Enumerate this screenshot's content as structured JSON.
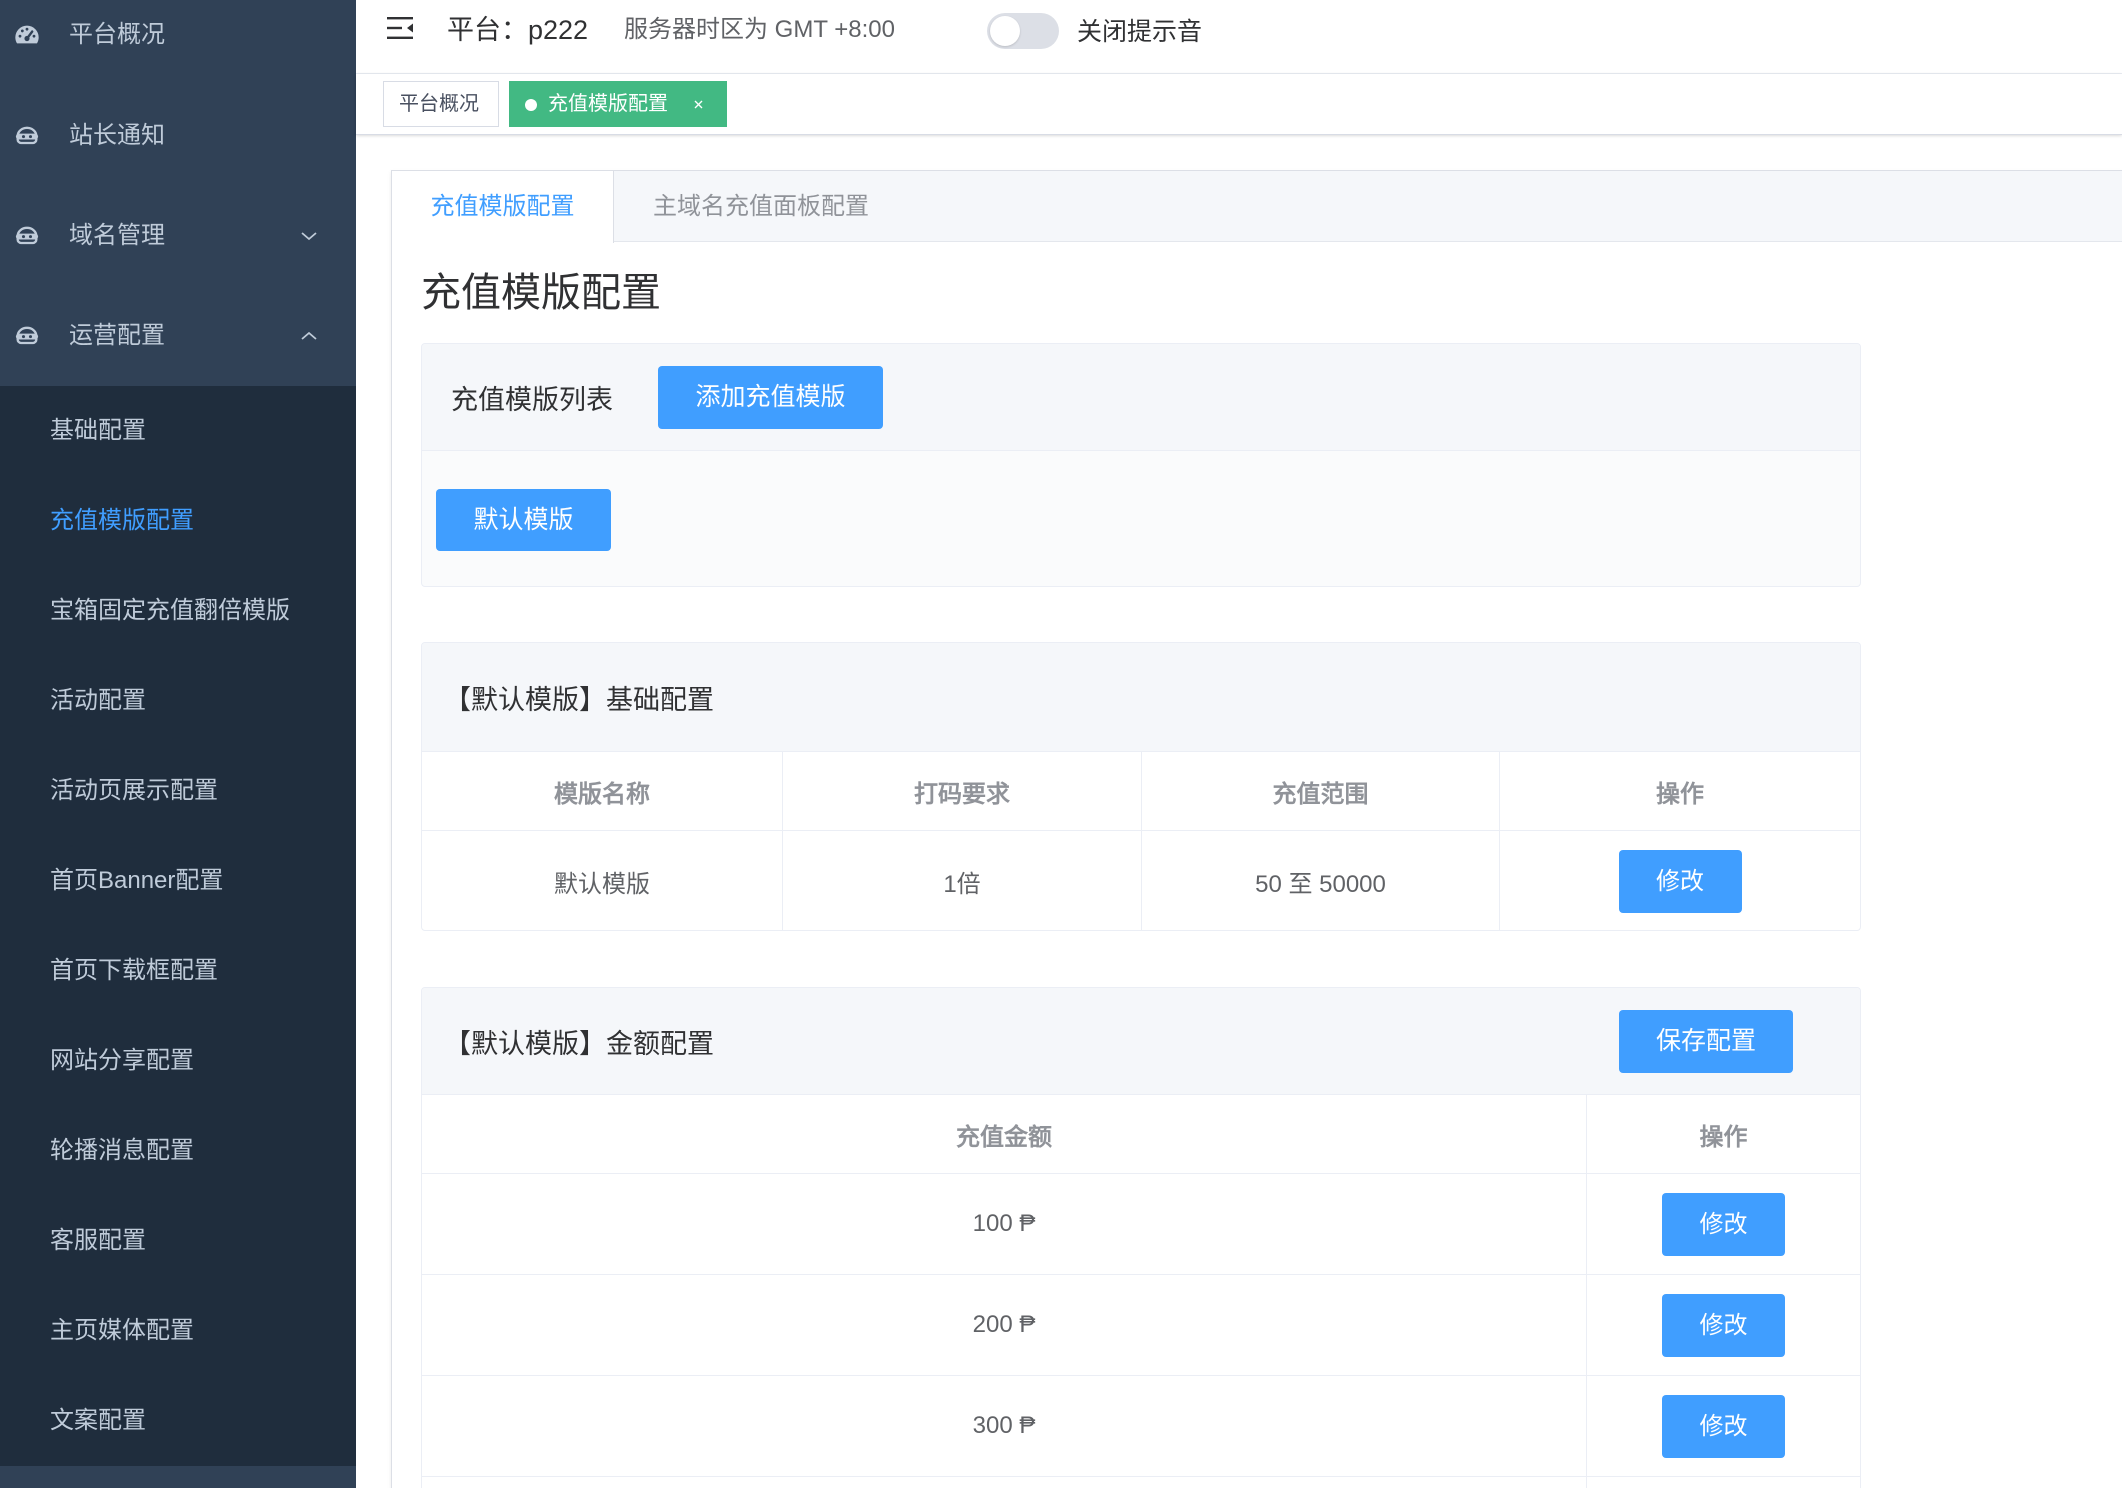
{
  "sidebar": {
    "menu": [
      {
        "label": "平台概况",
        "icon": "dashboard-icon"
      },
      {
        "label": "站长通知",
        "icon": "robot-icon"
      },
      {
        "label": "域名管理",
        "icon": "robot-icon",
        "expand_icon": "chevron-down-icon"
      },
      {
        "label": "运营配置",
        "icon": "robot-icon",
        "expand_icon": "chevron-up-icon"
      }
    ],
    "submenu": [
      "基础配置",
      "充值模版配置",
      "宝箱固定充值翻倍模版",
      "活动配置",
      "活动页展示配置",
      "首页Banner配置",
      "首页下载框配置",
      "网站分享配置",
      "轮播消息配置",
      "客服配置",
      "主页媒体配置",
      "文案配置"
    ],
    "active_submenu_index": 1
  },
  "header": {
    "platform_label": "平台：",
    "platform_value": "p222",
    "timezone": "服务器时区为 GMT +8:00",
    "sound_toggle_label": "关闭提示音",
    "sound_toggle_on": false
  },
  "tags": [
    {
      "label": "平台概况",
      "active": false
    },
    {
      "label": "充值模版配置",
      "active": true
    }
  ],
  "tabs": [
    {
      "label": "充值模版配置",
      "active": true
    },
    {
      "label": "主域名充值面板配置",
      "active": false
    }
  ],
  "page_title": "充值模版配置",
  "template_list": {
    "title": "充值模版列表",
    "add_button": "添加充值模版",
    "templates": [
      "默认模版"
    ]
  },
  "basic_config": {
    "title": "【默认模版】基础配置",
    "columns": [
      "模版名称",
      "打码要求",
      "充值范围",
      "操作"
    ],
    "rows": [
      {
        "name": "默认模版",
        "requirement": "1倍",
        "range": "50 至 50000",
        "action": "修改"
      }
    ]
  },
  "amount_config": {
    "title": "【默认模版】金额配置",
    "save_button": "保存配置",
    "columns": [
      "充值金额",
      "操作"
    ],
    "rows": [
      {
        "amount": "100 ₱",
        "action": "修改"
      },
      {
        "amount": "200 ₱",
        "action": "修改"
      },
      {
        "amount": "300 ₱",
        "action": "修改"
      }
    ]
  },
  "colors": {
    "primary": "#409eff",
    "tag_active": "#42b983",
    "sidebar": "#304156",
    "submenu": "#1f2d3d",
    "sidebar_text": "#bfcbd9"
  }
}
